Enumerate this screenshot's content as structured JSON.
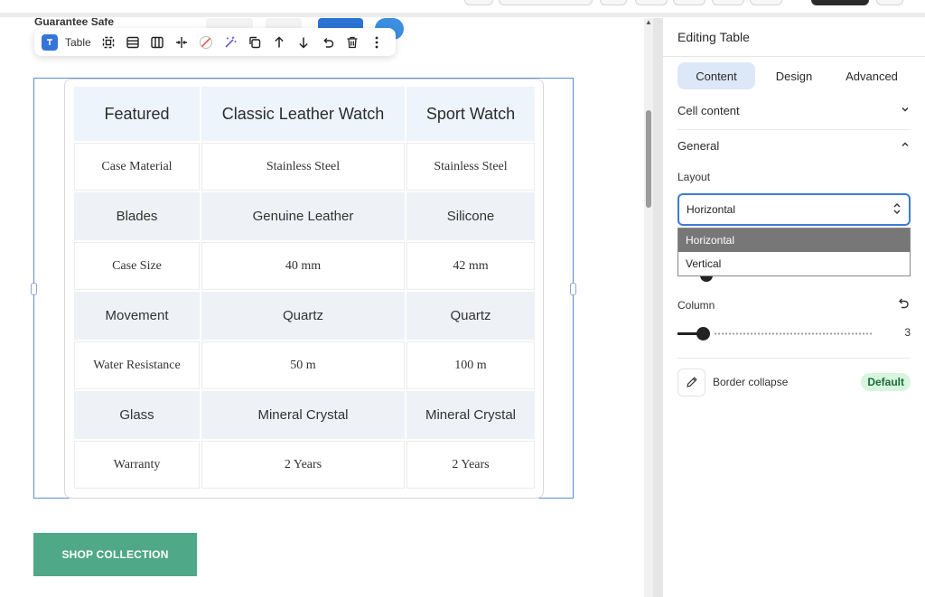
{
  "canvas": {
    "background_item_label": "Guarantee Safe",
    "toolbar": {
      "block_label": "Table",
      "tools": [
        "select-parent-icon",
        "table-rows-icon",
        "table-columns-icon",
        "split-cells-icon",
        "no-color-icon",
        "magic-wand-icon",
        "duplicate-icon",
        "move-up-icon",
        "move-down-icon",
        "undo-icon",
        "delete-icon",
        "more-icon"
      ]
    },
    "table": {
      "headers": [
        "Featured",
        "Classic Leather Watch",
        "Sport Watch"
      ],
      "rows": [
        [
          "Case Material",
          "Stainless Steel",
          "Stainless Steel"
        ],
        [
          "Blades",
          "Genuine Leather",
          "Silicone"
        ],
        [
          "Case Size",
          "40 mm",
          "42 mm"
        ],
        [
          "Movement",
          "Quartz",
          "Quartz"
        ],
        [
          "Water Resistance",
          "50 m",
          "100 m"
        ],
        [
          "Glass",
          "Mineral Crystal",
          "Mineral Crystal"
        ],
        [
          "Warranty",
          "2 Years",
          "2 Years"
        ]
      ]
    },
    "shop_button_label": "SHOP COLLECTION"
  },
  "panel": {
    "title": "Editing Table",
    "tabs": [
      {
        "label": "Content",
        "active": true
      },
      {
        "label": "Design",
        "active": false
      },
      {
        "label": "Advanced",
        "active": false
      }
    ],
    "cell_content_label": "Cell content",
    "general_label": "General",
    "layout": {
      "label": "Layout",
      "value": "Horizontal",
      "options": [
        "Horizontal",
        "Vertical"
      ]
    },
    "column": {
      "label": "Column",
      "value": "3"
    },
    "border_collapse": {
      "label": "Border collapse",
      "badge": "Default"
    }
  },
  "colors": {
    "accent": "#3c7bd6",
    "shop_button": "#4fa888",
    "header_cell": "#eef4fb",
    "badge_bg": "#d7f5df"
  }
}
